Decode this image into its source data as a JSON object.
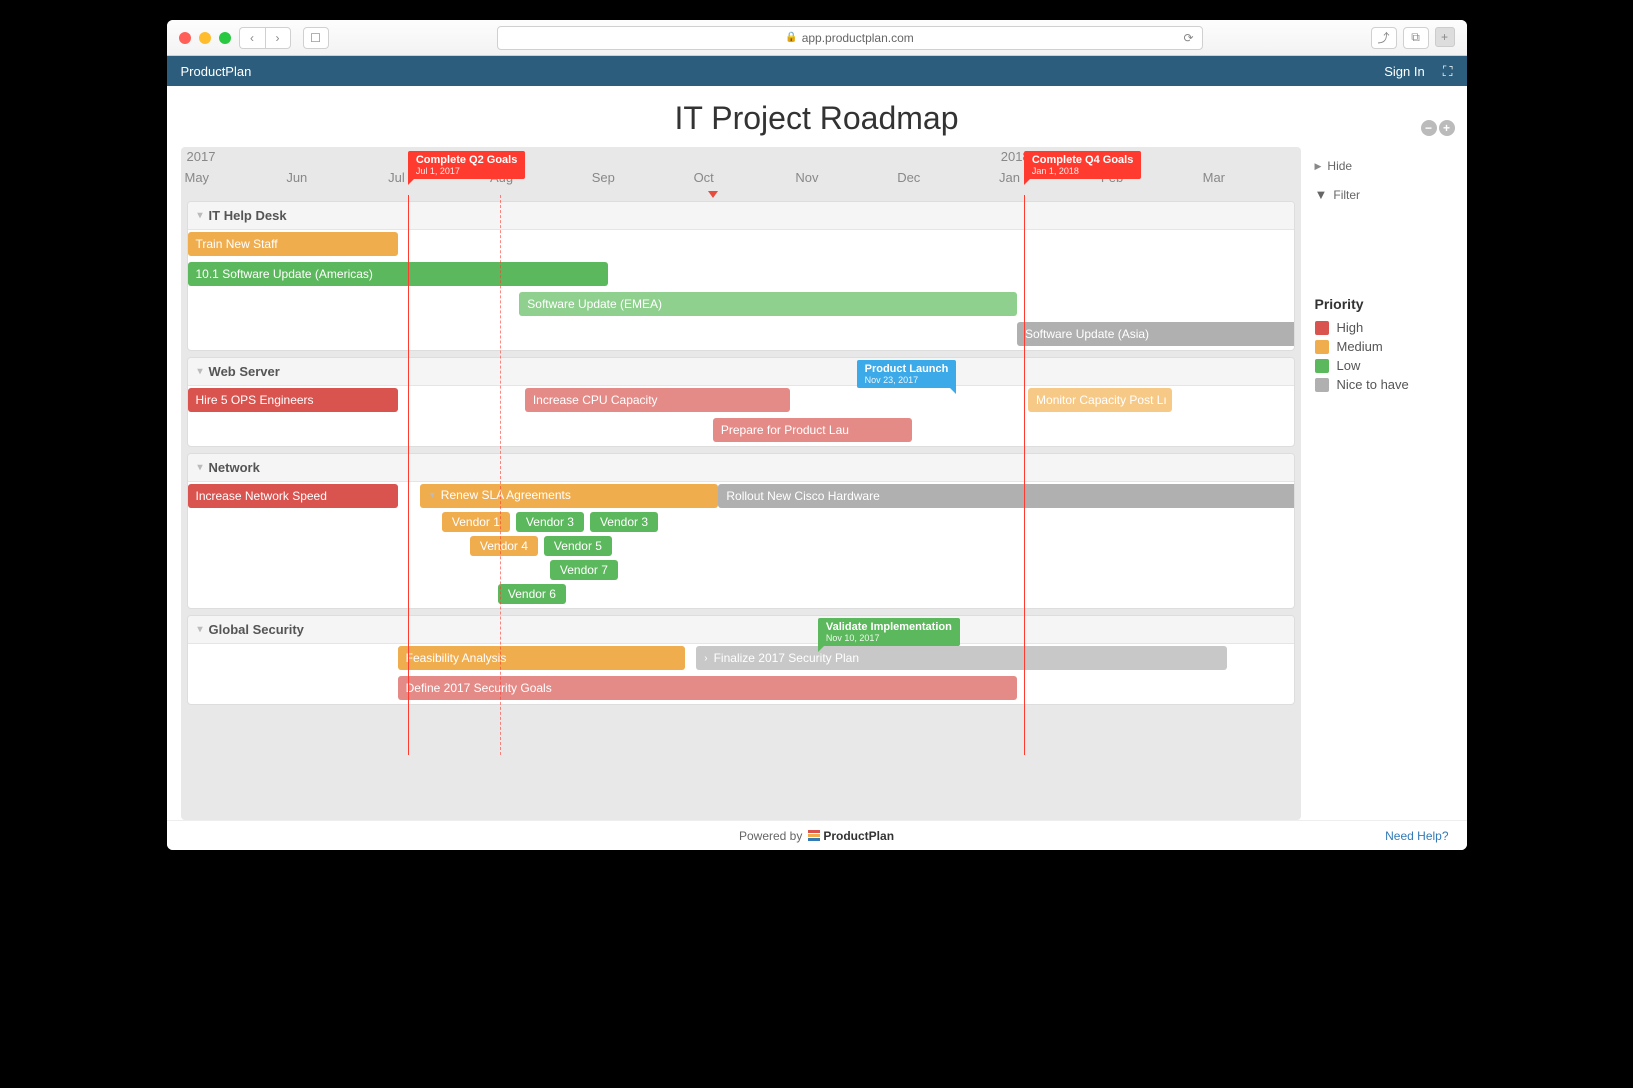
{
  "browser": {
    "url": "app.productplan.com"
  },
  "app": {
    "brand": "ProductPlan",
    "signIn": "Sign In"
  },
  "page": {
    "title": "IT Project Roadmap"
  },
  "timeline": {
    "year1": "2017",
    "year2": "2018",
    "months": [
      "May",
      "Jun",
      "Jul",
      "Aug",
      "Sep",
      "Oct",
      "Nov",
      "Dec",
      "Jan",
      "Feb",
      "Mar"
    ]
  },
  "milestones": {
    "q2": {
      "title": "Complete Q2 Goals",
      "date": "Jul 1, 2017"
    },
    "q4": {
      "title": "Complete Q4 Goals",
      "date": "Jan 1, 2018"
    },
    "launch": {
      "title": "Product Launch",
      "date": "Nov 23, 2017"
    },
    "validate": {
      "title": "Validate Implementation",
      "date": "Nov 10, 2017"
    }
  },
  "lanes": {
    "helpdesk": {
      "title": "IT Help Desk",
      "bars": {
        "train": "Train New Staff",
        "updAmericas": "10.1 Software Update (Americas)",
        "updEmea": "Software Update (EMEA)",
        "updAsia": "Software Update (Asia)"
      }
    },
    "webserver": {
      "title": "Web Server",
      "bars": {
        "hire": "Hire 5 OPS Engineers",
        "cpu": "Increase CPU Capacity",
        "prep": "Prepare for Product Lau",
        "monitor": "Monitor Capacity Post Lı"
      }
    },
    "network": {
      "title": "Network",
      "bars": {
        "speed": "Increase Network Speed",
        "sla": "Renew SLA Agreements",
        "cisco": "Rollout New Cisco Hardware",
        "v1": "Vendor 1",
        "v3a": "Vendor 3",
        "v3b": "Vendor 3",
        "v4": "Vendor 4",
        "v5": "Vendor 5",
        "v7": "Vendor 7",
        "v6": "Vendor 6"
      }
    },
    "security": {
      "title": "Global Security",
      "bars": {
        "feas": "Feasibility Analysis",
        "finalize": "Finalize 2017 Security Plan",
        "define": "Define 2017 Security Goals"
      }
    }
  },
  "sidebar": {
    "hide": "Hide",
    "filter": "Filter",
    "legendTitle": "Priority",
    "legend": {
      "high": "High",
      "medium": "Medium",
      "low": "Low",
      "nice": "Nice to have"
    }
  },
  "footer": {
    "powered": "Powered by",
    "brand": "ProductPlan",
    "help": "Need Help?"
  },
  "colors": {
    "high": "#d9534f",
    "medium": "#f0ad4e",
    "low": "#5cb85c",
    "nice": "#b0b0b0"
  }
}
